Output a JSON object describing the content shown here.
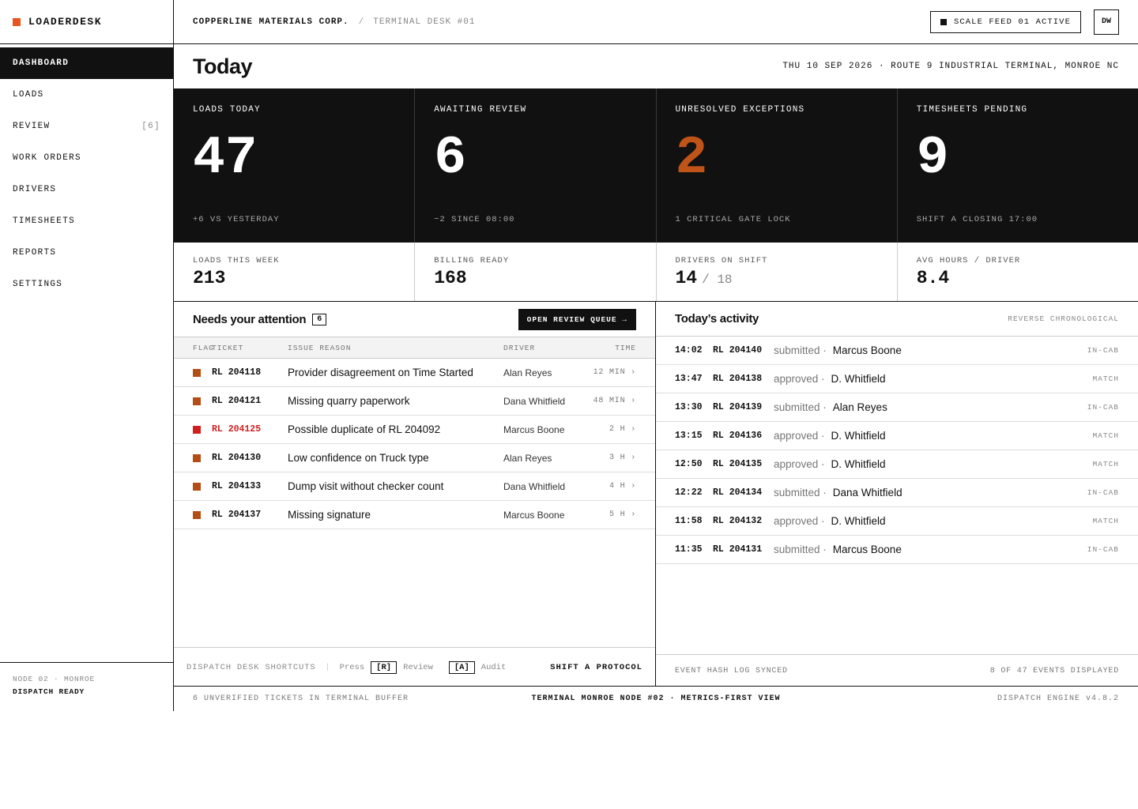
{
  "brand": {
    "name": "LOADERDESK",
    "accent": "#e8531f"
  },
  "sidebar": {
    "items": [
      {
        "label": "DASHBOARD",
        "badge": "",
        "active": true
      },
      {
        "label": "LOADS",
        "badge": ""
      },
      {
        "label": "REVIEW",
        "badge": "[6]"
      },
      {
        "label": "WORK ORDERS",
        "badge": ""
      },
      {
        "label": "DRIVERS",
        "badge": ""
      },
      {
        "label": "TIMESHEETS",
        "badge": ""
      },
      {
        "label": "REPORTS",
        "badge": ""
      },
      {
        "label": "SETTINGS",
        "badge": ""
      }
    ],
    "footer": {
      "node": "NODE 02 · MONROE",
      "status": "DISPATCH READY"
    }
  },
  "topbar": {
    "org": "COPPERLINE MATERIALS CORP.",
    "separator": "/",
    "desk": "TERMINAL DESK #01",
    "feed_status": "SCALE FEED 01 ACTIVE",
    "avatar": "DW"
  },
  "header": {
    "title": "Today",
    "meta": "THU 10 SEP 2026 · ROUTE 9 INDUSTRIAL TERMINAL, MONROE NC"
  },
  "kpis": [
    {
      "label": "LOADS TODAY",
      "value": "47",
      "sub": "+6 VS YESTERDAY"
    },
    {
      "label": "AWAITING REVIEW",
      "value": "6",
      "sub": "−2 SINCE 08:00"
    },
    {
      "label": "UNRESOLVED EXCEPTIONS",
      "value": "2",
      "sub": "1 CRITICAL GATE LOCK",
      "accent": "#c05418"
    },
    {
      "label": "TIMESHEETS PENDING",
      "value": "9",
      "sub": "SHIFT A CLOSING 17:00"
    }
  ],
  "stats": [
    {
      "label": "LOADS THIS WEEK",
      "value": "213",
      "of": ""
    },
    {
      "label": "BILLING READY",
      "value": "168",
      "of": ""
    },
    {
      "label": "DRIVERS ON SHIFT",
      "value": "14",
      "of": "/ 18"
    },
    {
      "label": "AVG HOURS / DRIVER",
      "value": "8.4",
      "of": ""
    }
  ],
  "attention": {
    "title": "Needs your attention",
    "count": "6",
    "button": "OPEN REVIEW QUEUE →",
    "columns": {
      "flag": "FLAG",
      "ticket": "TICKET",
      "issue": "ISSUE REASON",
      "driver": "DRIVER",
      "time": "TIME"
    },
    "rows": [
      {
        "ticket": "RL 204118",
        "issue": "Provider disagreement on Time Started",
        "driver": "Alan Reyes",
        "time": "12 MIN ›",
        "critical": false
      },
      {
        "ticket": "RL 204121",
        "issue": "Missing quarry paperwork",
        "driver": "Dana Whitfield",
        "time": "48 MIN ›",
        "critical": false
      },
      {
        "ticket": "RL 204125",
        "issue": "Possible duplicate of RL 204092",
        "driver": "Marcus Boone",
        "time": "2 H ›",
        "critical": true
      },
      {
        "ticket": "RL 204130",
        "issue": "Low confidence on Truck type",
        "driver": "Alan Reyes",
        "time": "3 H ›",
        "critical": false
      },
      {
        "ticket": "RL 204133",
        "issue": "Dump visit without checker count",
        "driver": "Dana Whitfield",
        "time": "4 H ›",
        "critical": false
      },
      {
        "ticket": "RL 204137",
        "issue": "Missing signature",
        "driver": "Marcus Boone",
        "time": "5 H ›",
        "critical": false
      }
    ],
    "footer": {
      "shortcuts_label": "DISPATCH DESK SHORTCUTS",
      "divider": "|",
      "press": "Press",
      "key_review": "[R]",
      "review": "Review",
      "key_audit": "[A]",
      "audit": "Audit",
      "protocol": "SHIFT A PROTOCOL"
    },
    "flag_color": "#b44d15",
    "critical_color": "#d11f1f"
  },
  "activity": {
    "title": "Today’s activity",
    "order": "REVERSE CHRONOLOGICAL",
    "rows": [
      {
        "time": "14:02",
        "ticket": "RL 204140",
        "verb": "submitted ·",
        "who": "Marcus Boone",
        "source": "IN-CAB"
      },
      {
        "time": "13:47",
        "ticket": "RL 204138",
        "verb": "approved ·",
        "who": "D. Whitfield",
        "source": "MATCH"
      },
      {
        "time": "13:30",
        "ticket": "RL 204139",
        "verb": "submitted ·",
        "who": "Alan Reyes",
        "source": "IN-CAB"
      },
      {
        "time": "13:15",
        "ticket": "RL 204136",
        "verb": "approved ·",
        "who": "D. Whitfield",
        "source": "MATCH"
      },
      {
        "time": "12:50",
        "ticket": "RL 204135",
        "verb": "approved ·",
        "who": "D. Whitfield",
        "source": "MATCH"
      },
      {
        "time": "12:22",
        "ticket": "RL 204134",
        "verb": "submitted ·",
        "who": "Dana Whitfield",
        "source": "IN-CAB"
      },
      {
        "time": "11:58",
        "ticket": "RL 204132",
        "verb": "approved ·",
        "who": "D. Whitfield",
        "source": "MATCH"
      },
      {
        "time": "11:35",
        "ticket": "RL 204131",
        "verb": "submitted ·",
        "who": "Marcus Boone",
        "source": "IN-CAB"
      }
    ],
    "footer": {
      "sync": "EVENT HASH LOG SYNCED",
      "count": "8 OF 47 EVENTS DISPLAYED"
    }
  },
  "statusbar": {
    "left": "6 UNVERIFIED TICKETS IN TERMINAL BUFFER",
    "center": "TERMINAL MONROE NODE #02 · METRICS-FIRST VIEW",
    "right": "DISPATCH ENGINE v4.8.2"
  }
}
